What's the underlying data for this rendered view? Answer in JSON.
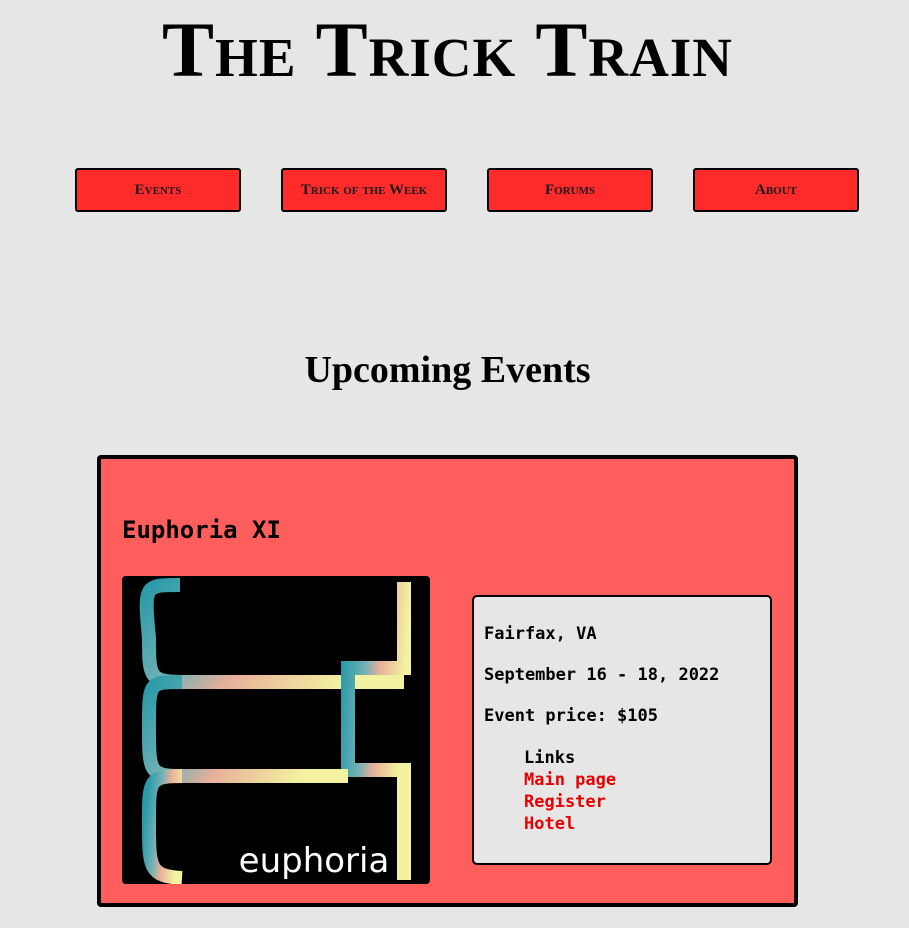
{
  "site": {
    "title": "The Trick Train"
  },
  "nav": {
    "items": [
      {
        "label": "Events"
      },
      {
        "label": "Trick of the Week"
      },
      {
        "label": "Forums"
      },
      {
        "label": "About"
      }
    ]
  },
  "main": {
    "heading": "Upcoming Events",
    "events": [
      {
        "name": "Euphoria XI",
        "image_text": "euphoria",
        "location": "Fairfax, VA",
        "dates": "September 16 - 18, 2022",
        "price": "Event price: $105",
        "links_label": "Links",
        "links": [
          {
            "label": "Main page"
          },
          {
            "label": "Register"
          },
          {
            "label": "Hotel"
          }
        ]
      }
    ]
  },
  "colors": {
    "background": "#e6e6e6",
    "nav_button": "#ff2a2a",
    "card": "#ff5f5c",
    "link": "#e60000"
  }
}
